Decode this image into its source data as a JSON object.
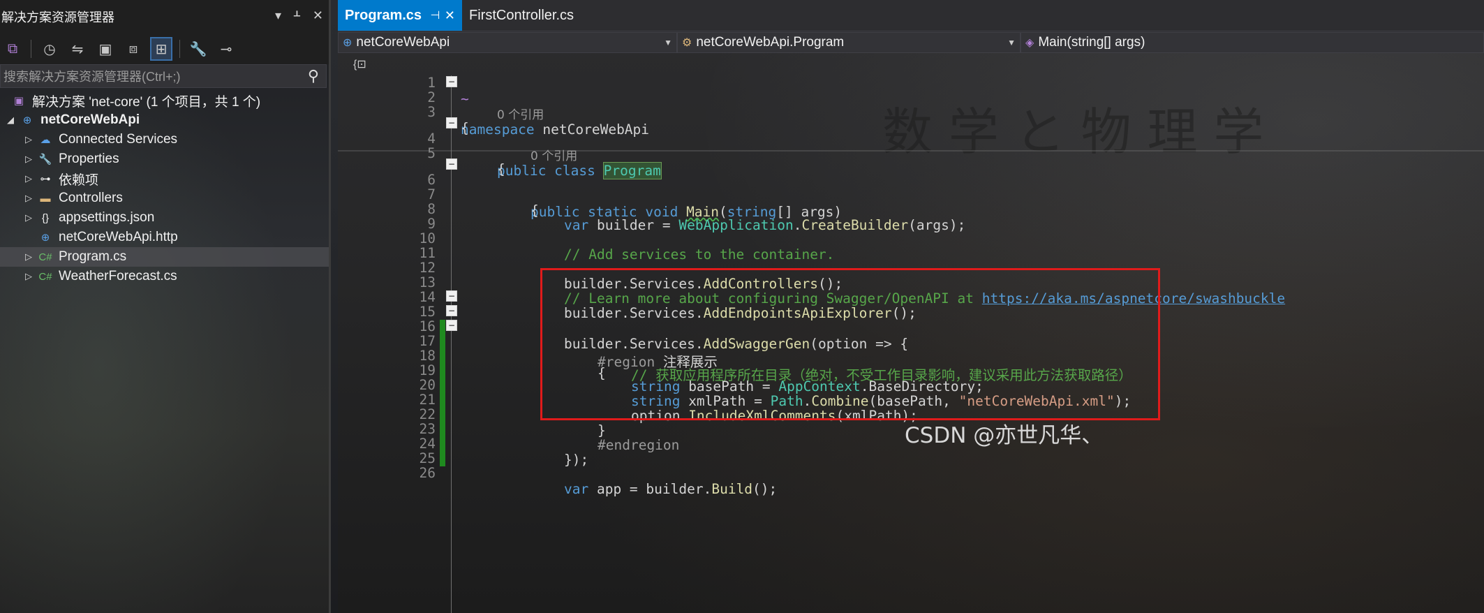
{
  "explorer": {
    "title": "解决方案资源管理器",
    "search_placeholder": "搜索解决方案资源管理器(Ctrl+;)",
    "solution": "解决方案 'net-core' (1 个项目，共 1 个)",
    "project": "netCoreWebApi",
    "items": [
      {
        "label": "Connected Services",
        "icon": "connected-services-icon"
      },
      {
        "label": "Properties",
        "icon": "properties-icon"
      },
      {
        "label": "依赖项",
        "icon": "dependencies-icon"
      },
      {
        "label": "Controllers",
        "icon": "folder-icon"
      },
      {
        "label": "appsettings.json",
        "icon": "json-file-icon"
      },
      {
        "label": "netCoreWebApi.http",
        "icon": "http-file-icon"
      },
      {
        "label": "Program.cs",
        "icon": "csharp-file-icon"
      },
      {
        "label": "WeatherForecast.cs",
        "icon": "csharp-file-icon"
      }
    ]
  },
  "tabs": {
    "active": "Program.cs",
    "inactive": "FirstController.cs"
  },
  "navbar": {
    "project": "netCoreWebApi",
    "class": "netCoreWebApi.Program",
    "member": "Main(string[] args)"
  },
  "codelens": {
    "class_refs": "0 个引用",
    "main_refs": "0 个引用"
  },
  "code": {
    "l2_kw": "namespace",
    "l2_name": " netCoreWebApi",
    "l4_kw": "public class ",
    "l4_name": "Program",
    "l6_kw": "public static void ",
    "l6_name": "Main",
    "l6_args_kw": "string",
    "l6_args": "[] args)",
    "l8_var": "var",
    "l8_a": " builder = ",
    "l8_type": "WebApplication",
    "l8_dot": ".",
    "l8_method": "CreateBuilder",
    "l8_end": "(args);",
    "l10": "// Add services to the container.",
    "l12_a": "builder.Services.",
    "l12_m": "AddControllers",
    "l12_e": "();",
    "l13_c": "// Learn more about configuring Swagger/OpenAPI at ",
    "l13_link": "https://aka.ms/aspnetcore/swashbuckle",
    "l14_a": "builder.Services.",
    "l14_m": "AddEndpointsApiExplorer",
    "l14_e": "();",
    "l15_a": "builder.Services.",
    "l15_m": "AddSwaggerGen",
    "l15_e": "(option => {",
    "l16_pp": "#region ",
    "l16_t": "注释展示",
    "l17": "{",
    "l18": "// 获取应用程序所在目录（绝对，不受工作目录影响，建议采用此方法获取路径）",
    "l19_kw": "string",
    "l19_a": " basePath = ",
    "l19_t": "AppContext",
    "l19_e": ".BaseDirectory;",
    "l20_kw": "string",
    "l20_a": " xmlPath = ",
    "l20_t": "Path",
    "l20_dot": ".",
    "l20_m": "Combine",
    "l20_b": "(basePath, ",
    "l20_s": "\"netCoreWebApi.xml\"",
    "l20_e": ");",
    "l21_a": "option.",
    "l21_m": "IncludeXmlComments",
    "l21_e": "(xmlPath);",
    "l22": "}",
    "l23": "#endregion",
    "l24": "});",
    "l26_kw": "var",
    "l26_a": " app = builder.",
    "l26_m": "Build",
    "l26_e": "();"
  },
  "line_numbers": [
    "1",
    "2",
    "3",
    "4",
    "5",
    "6",
    "7",
    "8",
    "9",
    "10",
    "11",
    "12",
    "13",
    "14",
    "15",
    "16",
    "17",
    "18",
    "19",
    "20",
    "21",
    "22",
    "23",
    "24",
    "25",
    "26"
  ],
  "watermark": "CSDN @亦世凡华、",
  "background_text": "数 学 と 物 理 学",
  "colors": {
    "accent": "#007acc",
    "keyword": "#569cd6",
    "type": "#4ec9b0",
    "method": "#dcdcaa",
    "comment": "#57a64a",
    "string": "#d69d85",
    "highlight_box": "#e01b1b",
    "change_bar": "#1f8a1f"
  }
}
